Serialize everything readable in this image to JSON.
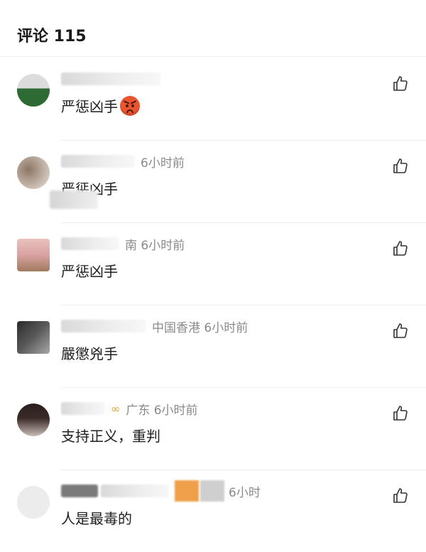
{
  "header": {
    "title": "评论 115"
  },
  "comments": [
    {
      "meta": "",
      "content": "严惩凶手",
      "emoji": "angry-face",
      "avatar_colors": [
        "#2e6b34",
        "#dcdcdc"
      ]
    },
    {
      "meta": "6小时前",
      "content": "严惩凶手",
      "avatar_colors": [
        "#b7a79a",
        "#e9e2dc"
      ]
    },
    {
      "meta": "南 6小时前",
      "content": "严惩凶手",
      "avatar_colors": [
        "#d9a2a2",
        "#efe7e2"
      ]
    },
    {
      "meta": "中国香港 6小时前",
      "content": "嚴懲兇手",
      "avatar_colors": [
        "#3c3c3c",
        "#a8a8a8"
      ]
    },
    {
      "meta": "广东 6小时前",
      "content": "支持正义，重判",
      "avatar_colors": [
        "#3a2a28",
        "#c8bcb8"
      ]
    },
    {
      "meta": "6小时",
      "content": "人是最毒的",
      "avatar_colors": [
        "#e9e9e9",
        "#f6f6f6"
      ]
    }
  ],
  "icons": {
    "like": "thumbs-up-icon",
    "emoji": "angry-face-icon"
  },
  "colors": {
    "meta_text": "#8a8a8a",
    "content_text": "#1f1f1f",
    "badge": "#e2a33c",
    "emoji": "#e8552f"
  }
}
